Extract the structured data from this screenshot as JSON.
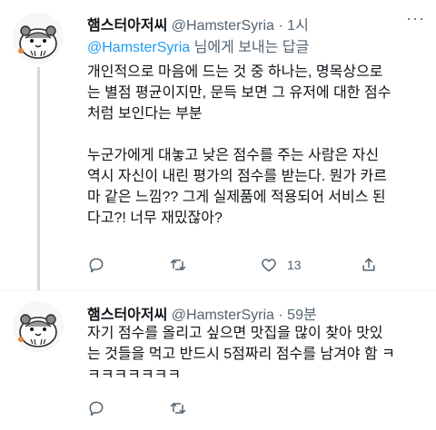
{
  "tweets": [
    {
      "name": "햄스터아저씨",
      "handle": "@HamsterSyria",
      "separator": "·",
      "time": "1시",
      "reply_mention": "@HamsterSyria",
      "reply_suffix": " 님에게 보내는 답글",
      "text": "개인적으로 마음에 드는 것 중 하나는, 명목상으로\n는 별점 평균이지만, 문득 보면 그 유저에 대한 점수\n처럼 보인다는 부분\n\n누군가에게 대놓고 낮은 점수를 주는 사람은 자신\n역시 자신이 내린 평가의 점수를 받는다. 뭔가 카르\n마 같은 느낌?? 그게 실제품에 적용되어 서비스 된\n다고?! 너무 재밌잖아?",
      "actions": {
        "reply_count": "",
        "retweet_count": "",
        "like_count": "13",
        "share_label": ""
      },
      "icons": [
        "reply-icon",
        "retweet-icon",
        "like-icon",
        "share-icon"
      ]
    },
    {
      "name": "햄스터아저씨",
      "handle": "@HamsterSyria",
      "separator": "·",
      "time": "59분",
      "text": "자기 점수를 올리고 싶으면 맛집을 많이 찾아 맛있\n는 것들을 먹고 반드시 5점짜리 점수를 남겨야 함 ㅋ\nㅋㅋㅋㅋㅋㅋㅋ",
      "actions": {
        "reply_count": "",
        "retweet_count": "",
        "like_count": "",
        "share_label": ""
      },
      "icons": [
        "reply-icon",
        "retweet-icon"
      ]
    }
  ],
  "colors": {
    "text": "#0f1419",
    "secondary": "#536471",
    "link": "#1d9bf0",
    "divider": "#eff3f4",
    "thread_line": "#cfd9de"
  }
}
